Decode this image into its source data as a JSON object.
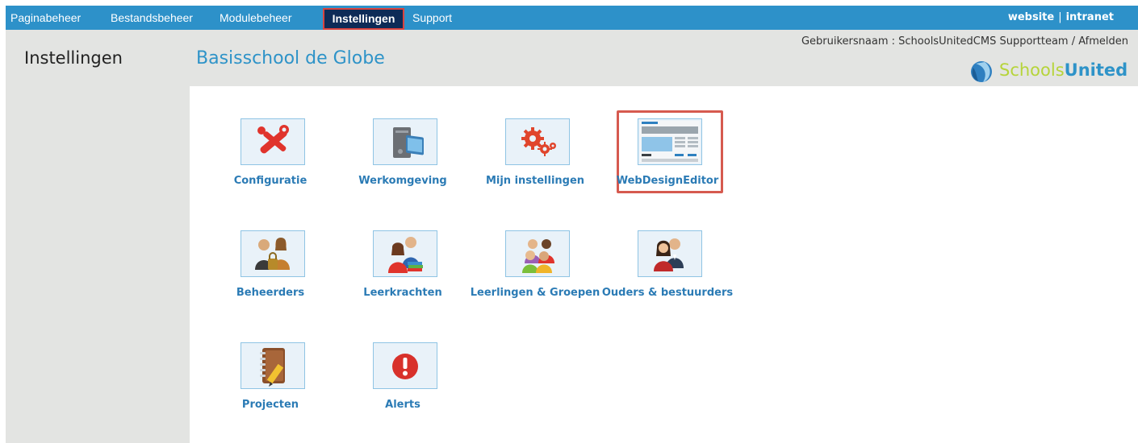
{
  "topnav": {
    "items": [
      "Paginabeheer",
      "Bestandsbeheer",
      "Modulebeheer",
      "Instellingen",
      "Support"
    ],
    "active": "Instellingen",
    "right": {
      "website": "website",
      "separator": "|",
      "intranet": "intranet"
    },
    "bar_color": "#2d91c9",
    "active_color": "#0d2b57",
    "highlight_color": "#d8443f"
  },
  "header": {
    "section_title": "Instellingen",
    "site_title": "Basisschool de Globe",
    "user_line": "Gebruikersnaam : SchoolsUnitedCMS Supportteam / Afmelden",
    "logo": {
      "part1": "Schools",
      "part2": "United"
    }
  },
  "tiles": [
    {
      "label": "Configuratie",
      "icon": "tools-icon"
    },
    {
      "label": "Werkomgeving",
      "icon": "computer-icon"
    },
    {
      "label": "Mijn instellingen",
      "icon": "gears-icon"
    },
    {
      "label": "WebDesignEditor",
      "icon": "layout-icon",
      "highlighted": true
    },
    {
      "label": "Beheerders",
      "icon": "admins-icon"
    },
    {
      "label": "Leerkrachten",
      "icon": "teachers-icon"
    },
    {
      "label": "Leerlingen & Groepen",
      "icon": "students-icon"
    },
    {
      "label": "Ouders & bestuurders",
      "icon": "parents-icon"
    },
    {
      "label": "Projecten",
      "icon": "notebook-icon"
    },
    {
      "label": "Alerts",
      "icon": "alert-icon"
    }
  ]
}
